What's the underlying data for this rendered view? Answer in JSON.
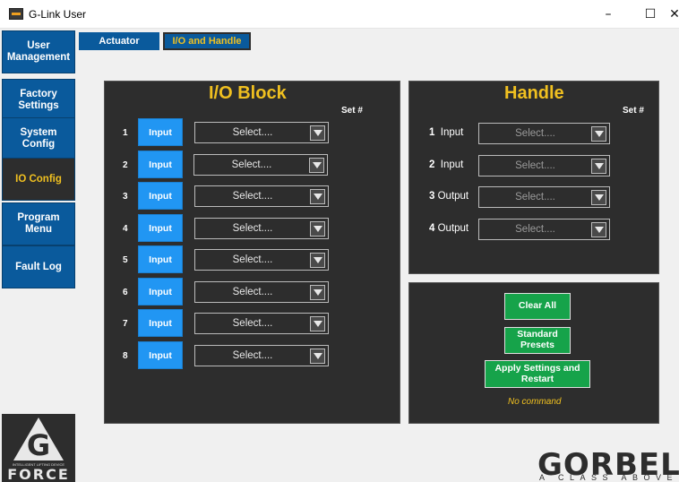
{
  "window": {
    "title": "G-Link User",
    "minimize": "–",
    "maximize": "☐",
    "close": "✕"
  },
  "sidebar": {
    "items": [
      {
        "label": "User\nManagement",
        "active": false
      },
      {
        "label": "Factory\nSettings",
        "active": false
      },
      {
        "label": "System\nConfig",
        "active": false
      },
      {
        "label": "IO Config",
        "active": true
      },
      {
        "label": "Program\nMenu",
        "active": false
      },
      {
        "label": "Fault Log",
        "active": false
      }
    ],
    "logo": {
      "tagline": "INTELLIGENT LIFTING DEVICE",
      "text": "FORCE",
      "letter": "G"
    }
  },
  "tabs": [
    {
      "label": "Actuator",
      "active": false
    },
    {
      "label": "I/O and Handle",
      "active": true
    }
  ],
  "io_block": {
    "title": "I/O Block",
    "set_label": "Set #",
    "rows": [
      {
        "num": "1",
        "button": "Input",
        "select": "Select...."
      },
      {
        "num": "2",
        "button": "Input",
        "select": "Select...."
      },
      {
        "num": "3",
        "button": "Input",
        "select": "Select...."
      },
      {
        "num": "4",
        "button": "Input",
        "select": "Select...."
      },
      {
        "num": "5",
        "button": "Input",
        "select": "Select...."
      },
      {
        "num": "6",
        "button": "Input",
        "select": "Select...."
      },
      {
        "num": "7",
        "button": "Input",
        "select": "Select...."
      },
      {
        "num": "8",
        "button": "Input",
        "select": "Select...."
      }
    ]
  },
  "handle": {
    "title": "Handle",
    "set_label": "Set #",
    "rows": [
      {
        "num": "1",
        "type": "Input",
        "select": "Select...."
      },
      {
        "num": "2",
        "type": "Input",
        "select": "Select...."
      },
      {
        "num": "3",
        "type": "Output",
        "select": "Select...."
      },
      {
        "num": "4",
        "type": "Output",
        "select": "Select...."
      }
    ]
  },
  "actions": {
    "clear_all": "Clear All",
    "standard_presets": "Standard\nPresets",
    "apply_restart": "Apply Settings and\nRestart",
    "status": "No command"
  },
  "brand": {
    "name": "GORBEL",
    "tagline": "A CLASS ABOVE"
  }
}
